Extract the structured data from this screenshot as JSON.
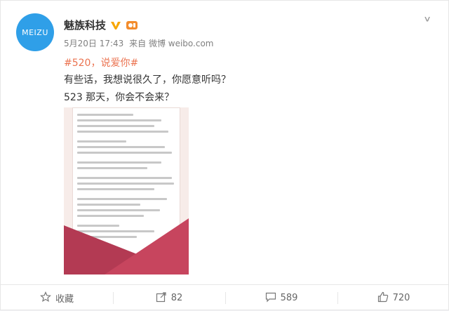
{
  "post": {
    "avatar_text": "MEIZU",
    "author": "魅族科技",
    "time": "5月20日 17:43",
    "source": "来自 微博 weibo.com",
    "topic": "#520，说爱你#",
    "lines": [
      "有些话，我想说很久了，你愿意听吗？",
      "523 那天，你会不会来？"
    ],
    "icon_verified": "verified-v-icon",
    "icon_level": "member-level-icon"
  },
  "toolbar": {
    "favorite_label": "收藏",
    "repost_count": "82",
    "comment_count": "589",
    "like_count": "720"
  },
  "colors": {
    "brand_blue": "#2f9fe8",
    "topic_orange": "#eb7350",
    "envelope_red": "#b33a53"
  }
}
